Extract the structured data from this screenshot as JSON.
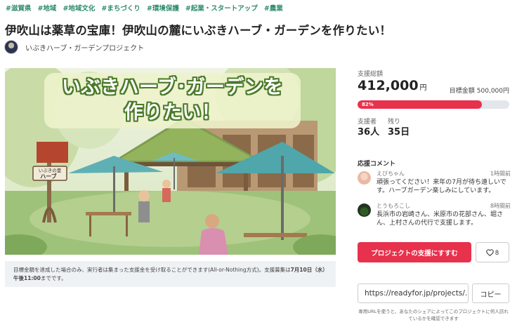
{
  "tags": [
    "#滋賀県",
    "#地域",
    "#地域文化",
    "#まちづくり",
    "#環境保護",
    "#起業・スタートアップ",
    "#農業"
  ],
  "title": "伊吹山は薬草の宝庫！伊吹山の麓にいぶきハーブ・ガーデンを作りたい！",
  "owner": {
    "name": "いぶきハーブ・ガーデンプロジェクト"
  },
  "hero": {
    "title_line1": "いぶきハーブ･ガーデンを",
    "title_line2": "作りたい！",
    "sign_text": "いぶきの里\nハーブ"
  },
  "notice": {
    "text": "目標金額を達成した場合のみ、実行者は集まった支援金を受け取ることができます(All-or-Nothing方式)。支援募集は",
    "deadline": "7月10日（水）午後11:00",
    "suffix": "までです。"
  },
  "stats": {
    "total_label": "支援総額",
    "total_amount": "412,000",
    "unit": "円",
    "goal_label": "目標金額",
    "goal_amount": "500,000円",
    "progress_percent": 82,
    "progress_text": "82%",
    "supporters_label": "支援者",
    "supporters_value": "36人",
    "remaining_label": "残り",
    "remaining_value": "35日"
  },
  "comments": {
    "heading": "応援コメント",
    "items": [
      {
        "name": "えびちゃん",
        "time": "1時間前",
        "text": "頑張ってください！来年の7月が待ち遠しいです。ハーブガーデン楽しみにしています。"
      },
      {
        "name": "とうもろこし",
        "time": "8時間前",
        "text": "長浜市の岩崎さん、米原市の花部さん、堀さん、上村さんの代行で支援します。"
      }
    ]
  },
  "actions": {
    "support_button": "プロジェクトの支援にすすむ",
    "favorite_count": "8",
    "url": "https://readyfor.jp/projects/...",
    "copy_button": "コピー",
    "url_note": "専用URLを使うと、あなたのシェアによってこのプロジェクトに何人訪れているかを確認できます"
  },
  "colors": {
    "accent": "#e8314c",
    "tag": "#2e8b6b"
  }
}
